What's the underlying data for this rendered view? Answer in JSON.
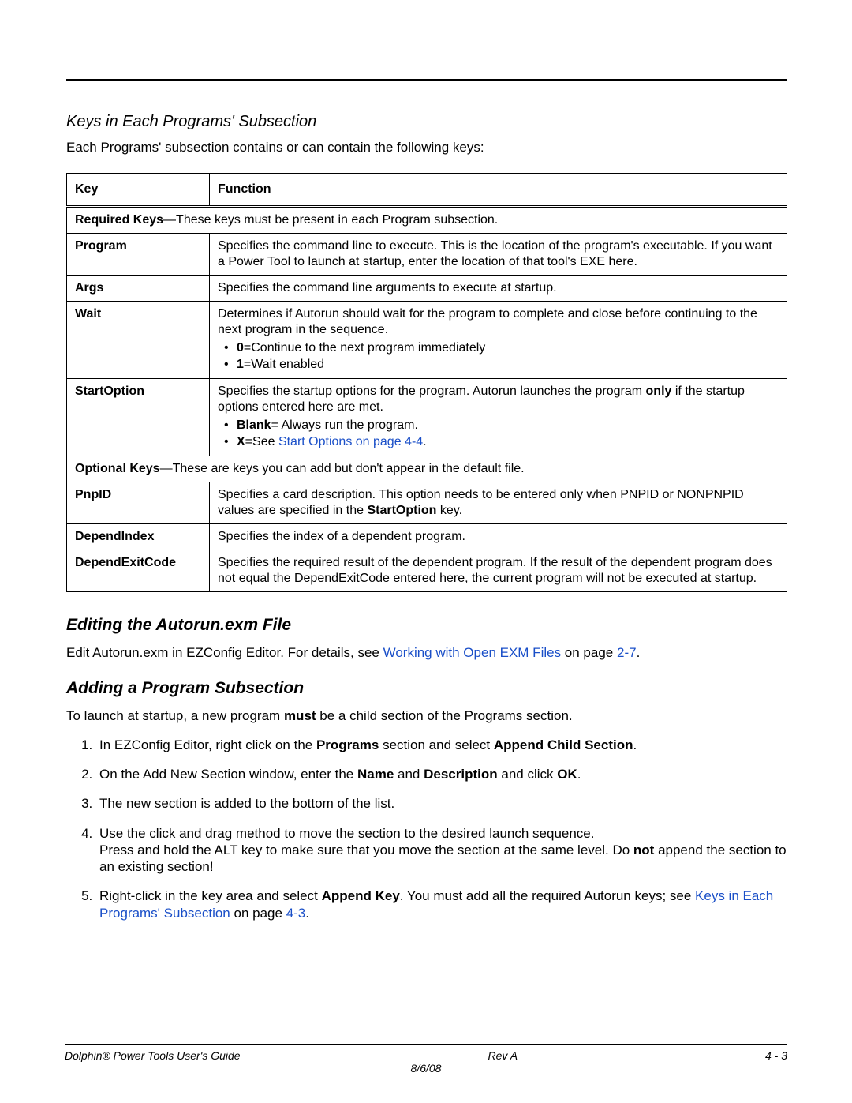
{
  "h1": "Keys in Each Programs' Subsection",
  "intro": "Each Programs' subsection contains or can contain the following keys:",
  "thead": {
    "c1": "Key",
    "c2": "Function"
  },
  "reqBanner": {
    "bold": "Required Keys",
    "rest": "—These keys must be present in each Program subsection."
  },
  "rows": {
    "program": {
      "k": "Program",
      "v": "Specifies the command line to execute. This is the location of the program's executable. If you want a Power Tool to launch at startup, enter the location of that tool's EXE here."
    },
    "args": {
      "k": "Args",
      "v": "Specifies the command line arguments to execute at startup."
    },
    "wait": {
      "k": "Wait",
      "lead": "Determines if Autorun should wait for the program to complete and close before continuing to the next program in the sequence.",
      "i1b": "0",
      "i1r": "=Continue to the next program immediately",
      "i2b": "1",
      "i2r": "=Wait enabled"
    },
    "start": {
      "k": "StartOption",
      "leadA": "Specifies the startup options for the program. Autorun launches the program ",
      "only": "only",
      "leadB": " if the startup options entered here are met.",
      "i1b": "Blank",
      "i1r": "= Always run the program.",
      "i2b": "X",
      "i2eq": "=See ",
      "i2link": "Start Options on page 4-4",
      "i2dot": "."
    }
  },
  "optBanner": {
    "bold": "Optional Keys",
    "rest": "—These are keys you can add but don't appear in the default file."
  },
  "rows2": {
    "pnpid": {
      "k": "PnpID",
      "va": "Specifies a card description. This option needs to be entered only when PNPID or NONPNPID values are specified in the ",
      "vb": "StartOption",
      "vc": " key."
    },
    "depIdx": {
      "k": "DependIndex",
      "v": "Specifies the index of a dependent program."
    },
    "depExit": {
      "k": "DependExitCode",
      "v": "Specifies the required result of the dependent program. If the result of the dependent program does not equal the DependExitCode entered here, the current program will not be executed at startup."
    }
  },
  "h2": "Editing the Autorun.exm File",
  "editPara": {
    "a": "Edit Autorun.exm in EZConfig Editor. For details, see ",
    "link": "Working with Open EXM Files",
    "b": " on page ",
    "page": "2-7",
    "dot": "."
  },
  "h3": "Adding a Program Subsection",
  "addIntro": {
    "a": "To launch at startup, a new program ",
    "b": "must",
    "c": " be a child section of the Programs section."
  },
  "steps": {
    "s1a": "In EZConfig Editor, right click on the ",
    "s1b": "Programs",
    "s1c": " section and select ",
    "s1d": "Append Child Section",
    "s1e": ".",
    "s2a": "On the Add New Section window, enter the ",
    "s2b": "Name",
    "s2c": " and ",
    "s2d": "Description",
    "s2e": " and click ",
    "s2f": "OK",
    "s2g": ".",
    "s3": "The new section is added to the bottom of the list.",
    "s4a": "Use the click and drag method to move the section to the desired launch sequence.",
    "s4b": "Press and hold the ALT key to make sure that you move the section at the same level. Do ",
    "s4c": "not",
    "s4d": " append the section to an existing section!",
    "s5a": "Right-click in the key area and select ",
    "s5b": "Append Key",
    "s5c": ". You must add all the required Autorun keys; see ",
    "s5link": "Keys in Each Programs' Subsection",
    "s5d": " on page ",
    "s5page": "4-3",
    "s5e": "."
  },
  "footer": {
    "left": "Dolphin® Power Tools User's Guide",
    "center": "Rev A",
    "right": "4 - 3",
    "sub": "8/6/08"
  }
}
